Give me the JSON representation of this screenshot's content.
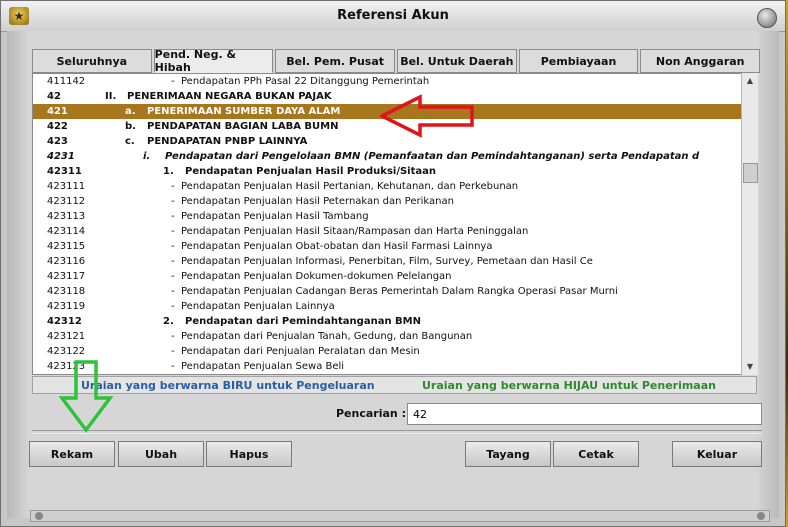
{
  "window": {
    "title": "Referensi Akun"
  },
  "icons": {
    "app": "treasury-emblem-icon",
    "close": "close-icon"
  },
  "tabs": [
    {
      "label": "Seluruhnya",
      "name": "tab-seluruhnya"
    },
    {
      "label": "Pend. Neg. & Hibah",
      "name": "tab-pend-neg-hibah",
      "active": true
    },
    {
      "label": "Bel. Pem. Pusat",
      "name": "tab-bel-pem-pusat"
    },
    {
      "label": "Bel. Untuk Daerah",
      "name": "tab-bel-untuk-daerah"
    },
    {
      "label": "Pembiayaan",
      "name": "tab-pembiayaan"
    },
    {
      "label": "Non Anggaran",
      "name": "tab-non-anggaran"
    }
  ],
  "rows": [
    {
      "code": "411142",
      "marker": "-",
      "text": "Pendapatan PPh Pasal 22 Ditanggung Pemerintah",
      "level": 4
    },
    {
      "code": "42",
      "marker": "II.",
      "text": "PENERIMAAN NEGARA BUKAN PAJAK",
      "level": 1,
      "bold": true
    },
    {
      "code": "421",
      "marker": "a.",
      "text": "PENERIMAAN SUMBER DAYA ALAM",
      "level": 2,
      "bold": true,
      "selected": true
    },
    {
      "code": "422",
      "marker": "b.",
      "text": "PENDAPATAN BAGIAN LABA BUMN",
      "level": 2,
      "bold": true
    },
    {
      "code": "423",
      "marker": "c.",
      "text": "PENDAPATAN PNBP LAINNYA",
      "level": 2,
      "bold": true
    },
    {
      "code": "4231",
      "marker": "i.",
      "text": "Pendapatan dari Pengelolaan BMN (Pemanfaatan dan Pemindahtanganan) serta Pendapatan d",
      "level": 3,
      "bold": true,
      "italic": true
    },
    {
      "code": "42311",
      "marker": "1.",
      "text": "Pendapatan Penjualan Hasil Produksi/Sitaan",
      "level": 3.5,
      "bold": true
    },
    {
      "code": "423111",
      "marker": "-",
      "text": "Pendapatan Penjualan Hasil Pertanian, Kehutanan, dan Perkebunan",
      "level": 4
    },
    {
      "code": "423112",
      "marker": "-",
      "text": "Pendapatan Penjualan Hasil Peternakan dan Perikanan",
      "level": 4
    },
    {
      "code": "423113",
      "marker": "-",
      "text": "Pendapatan Penjualan Hasil Tambang",
      "level": 4
    },
    {
      "code": "423114",
      "marker": "-",
      "text": "Pendapatan Penjualan Hasil Sitaan/Rampasan dan Harta Peninggalan",
      "level": 4
    },
    {
      "code": "423115",
      "marker": "-",
      "text": "Pendapatan Penjualan Obat-obatan dan Hasil Farmasi Lainnya",
      "level": 4
    },
    {
      "code": "423116",
      "marker": "-",
      "text": "Pendapatan Penjualan Informasi, Penerbitan, Film, Survey, Pemetaan dan Hasil Ce",
      "level": 4
    },
    {
      "code": "423117",
      "marker": "-",
      "text": "Pendapatan Penjualan Dokumen-dokumen Pelelangan",
      "level": 4
    },
    {
      "code": "423118",
      "marker": "-",
      "text": "Pendapatan Penjualan Cadangan Beras Pemerintah Dalam Rangka Operasi Pasar Murni",
      "level": 4
    },
    {
      "code": "423119",
      "marker": "-",
      "text": "Pendapatan Penjualan Lainnya",
      "level": 4
    },
    {
      "code": "42312",
      "marker": "2.",
      "text": "Pendapatan dari Pemindahtanganan BMN",
      "level": 3.5,
      "bold": true
    },
    {
      "code": "423121",
      "marker": "-",
      "text": "Pendapatan dari Penjualan Tanah, Gedung, dan Bangunan",
      "level": 4
    },
    {
      "code": "423122",
      "marker": "-",
      "text": "Pendapatan dari Penjualan Peralatan dan Mesin",
      "level": 4
    },
    {
      "code": "423123",
      "marker": "-",
      "text": "Pendapatan Penjualan Sewa Beli",
      "level": 4
    }
  ],
  "legend": {
    "blue": "Uraian yang berwarna BIRU untuk Pengeluaran",
    "green": "Uraian yang berwarna HIJAU untuk Penerimaan"
  },
  "search": {
    "label": "Pencarian :",
    "value": "42"
  },
  "buttons": {
    "rekam": "Rekam",
    "ubah": "Ubah",
    "hapus": "Hapus",
    "tayang": "Tayang",
    "cetak": "Cetak",
    "keluar": "Keluar"
  },
  "colors": {
    "selected_row": "#a8761c",
    "legend_blue": "#2a5ea8",
    "legend_green": "#2f8a2f",
    "annotation_red": "#e0141a",
    "annotation_green": "#2ec23a"
  }
}
